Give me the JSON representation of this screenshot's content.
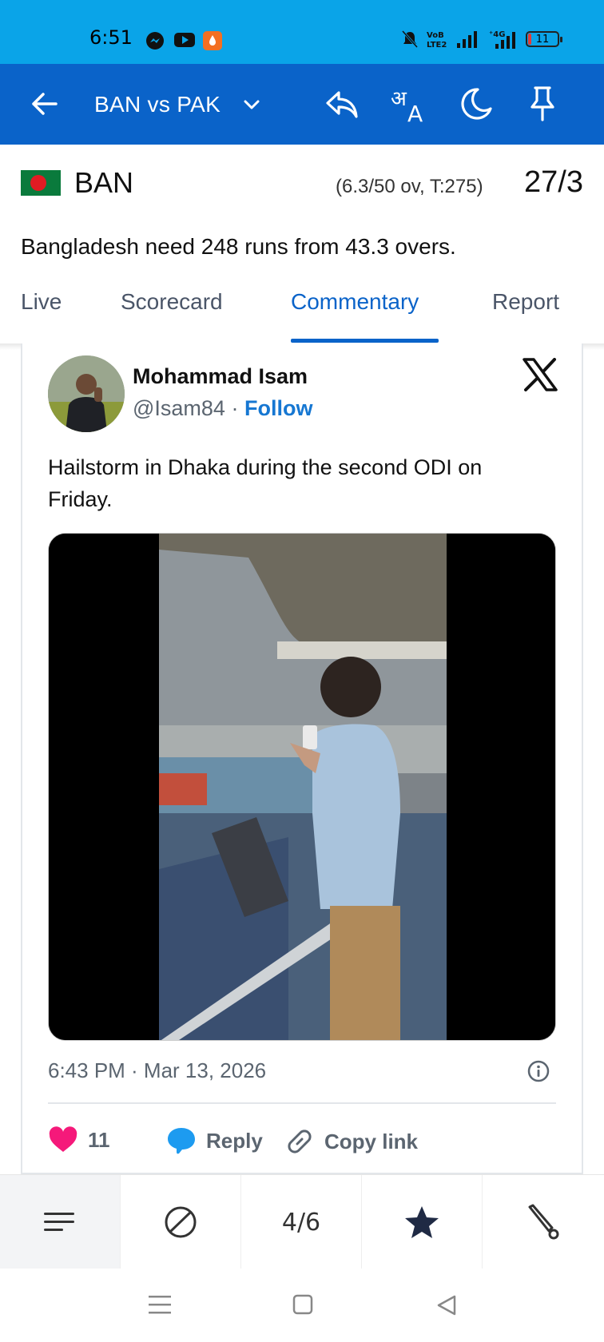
{
  "status_bar": {
    "time": "6:51",
    "network": "4G",
    "battery": "11"
  },
  "app_bar": {
    "title": "BAN vs PAK",
    "icons": [
      "back-arrow-icon",
      "chevron-down-icon",
      "share-icon",
      "translate-icon",
      "dark-mode-icon",
      "pin-icon"
    ]
  },
  "score": {
    "team": "BAN",
    "overs": "(6.3/50 ov, T:275)",
    "runs": "27/3",
    "summary": "Bangladesh need 248 runs from 43.3 overs."
  },
  "tabs": [
    {
      "label": "Live",
      "active": false
    },
    {
      "label": "Scorecard",
      "active": false
    },
    {
      "label": "Commentary",
      "active": true
    },
    {
      "label": "Report",
      "active": false
    }
  ],
  "tweet": {
    "author": "Mohammad Isam",
    "handle": "@Isam84",
    "separator": "·",
    "follow": "Follow",
    "text": "Hailstorm in Dhaka during the second ODI on Friday.",
    "timestamp": "6:43 PM · Mar 13, 2026",
    "likes": "11",
    "reply": "Reply",
    "copy_link": "Copy link"
  },
  "bottom_nav": {
    "page": "4/6"
  },
  "colors": {
    "status_bar": "#0aa4e8",
    "app_bar": "#0a63c9",
    "accent": "#0a63c9",
    "like": "#f5197a",
    "reply": "#1d9bf0"
  }
}
